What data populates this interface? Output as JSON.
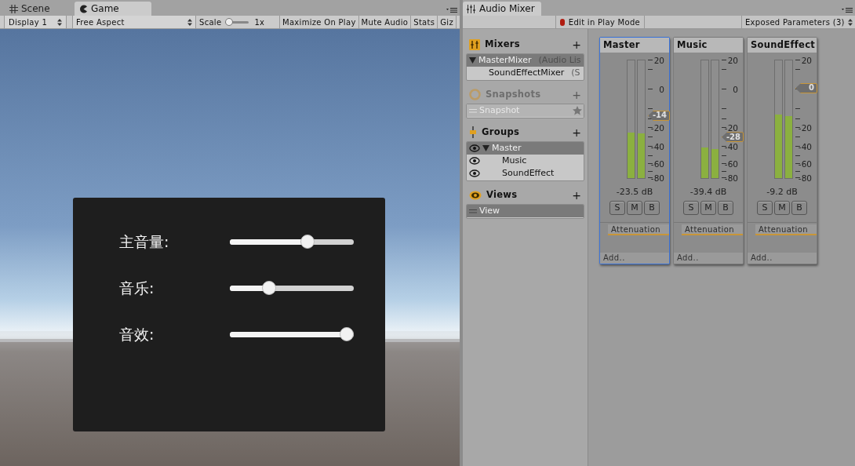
{
  "game_window": {
    "tabs": [
      {
        "label": "Scene",
        "selected": false
      },
      {
        "label": "Game",
        "selected": true
      }
    ],
    "toolbar": {
      "display": "Display 1",
      "aspect": "Free Aspect",
      "scale_label": "Scale",
      "scale_value": "1x",
      "toggles": [
        {
          "label": "Maximize On Play",
          "on": false
        },
        {
          "label": "Mute Audio",
          "on": false
        },
        {
          "label": "Stats",
          "on": false
        },
        {
          "label": "Giz",
          "on": false
        }
      ]
    },
    "view": {
      "kind": "picture",
      "panel": {
        "sliders": [
          {
            "label": "主音量:",
            "level": 0.64
          },
          {
            "label": "音乐:",
            "level": 0.29
          },
          {
            "label": "音效:",
            "level": 1
          }
        ]
      }
    }
  },
  "mixer_window": {
    "tab": {
      "label": "Audio Mixer",
      "selected": true
    },
    "toolbar": {
      "edit_in_play_mode": {
        "label": "Edit in Play Mode",
        "on": true
      },
      "exposed_parameters": "Exposed Parameters (3)"
    },
    "sidebar": {
      "sections": [
        {
          "kind": "mixers",
          "title": "Mixers",
          "add_button": "+",
          "disabled": false,
          "items": [
            {
              "label": "MasterMixer",
              "note": "(Audio Lis",
              "selected": true,
              "expanded": true,
              "children": [
                {
                  "label": "SoundEffectMixer",
                  "note": "(S",
                  "selected": false
                }
              ]
            }
          ]
        },
        {
          "kind": "snapshots",
          "title": "Snapshots",
          "add_button": "+",
          "disabled": true,
          "items": [
            {
              "label": "Snapshot",
              "selected": true
            }
          ]
        },
        {
          "kind": "groups",
          "title": "Groups",
          "add_button": "+",
          "disabled": false,
          "items": [
            {
              "label": "Master",
              "selected": true,
              "expanded": true,
              "children": [
                {
                  "label": "Music",
                  "selected": false
                },
                {
                  "label": "SoundEffect",
                  "selected": false
                }
              ]
            }
          ]
        },
        {
          "kind": "views",
          "title": "Views",
          "add_button": "+",
          "disabled": false,
          "items": [
            {
              "label": "View",
              "selected": true
            }
          ]
        }
      ]
    },
    "strips": [
      {
        "name": "Master",
        "selected": true,
        "scale_labels": [
          {
            "kind": "plus20",
            "text": "20"
          },
          {
            "kind": "zero",
            "text": "0"
          },
          {
            "kind": "minus20",
            "text": "-20"
          },
          {
            "kind": "minus40",
            "text": "-40"
          },
          {
            "kind": "minus60",
            "text": "-60"
          },
          {
            "kind": "minus80",
            "text": "-80"
          }
        ],
        "meter_left": {
          "level": 0.39
        },
        "meter_right": {
          "level": 0.38
        },
        "fader": {
          "reading": "-14"
        },
        "db": "-23.5 dB",
        "buttons": [
          "S",
          "M",
          "B"
        ],
        "effect": "Attenuation",
        "add": "Add.."
      },
      {
        "name": "Music",
        "selected": false,
        "scale_labels": [
          {
            "kind": "plus20",
            "text": "20"
          },
          {
            "kind": "zero",
            "text": "0"
          },
          {
            "kind": "minus20",
            "text": "-20"
          },
          {
            "kind": "minus40",
            "text": "-40"
          },
          {
            "kind": "minus60",
            "text": "-60"
          },
          {
            "kind": "minus80",
            "text": "-80"
          }
        ],
        "meter_left": {
          "level": 0.26
        },
        "meter_right": {
          "level": 0.25
        },
        "fader": {
          "reading": "-28"
        },
        "db": "-39.4 dB",
        "buttons": [
          "S",
          "M",
          "B"
        ],
        "effect": "Attenuation",
        "add": "Add.."
      },
      {
        "name": "SoundEffect",
        "selected": false,
        "scale_labels": [
          {
            "kind": "plus20",
            "text": "20"
          },
          {
            "kind": "minus20",
            "text": "-20"
          },
          {
            "kind": "minus40",
            "text": "-40"
          },
          {
            "kind": "minus60",
            "text": "-60"
          },
          {
            "kind": "minus80",
            "text": "-80"
          }
        ],
        "meter_left": {
          "level": 0.54
        },
        "meter_right": {
          "level": 0.53
        },
        "fader": {
          "reading": "0"
        },
        "db": "-9.2 dB",
        "buttons": [
          "S",
          "M",
          "B"
        ],
        "effect": "Attenuation",
        "add": "Add.."
      }
    ]
  }
}
